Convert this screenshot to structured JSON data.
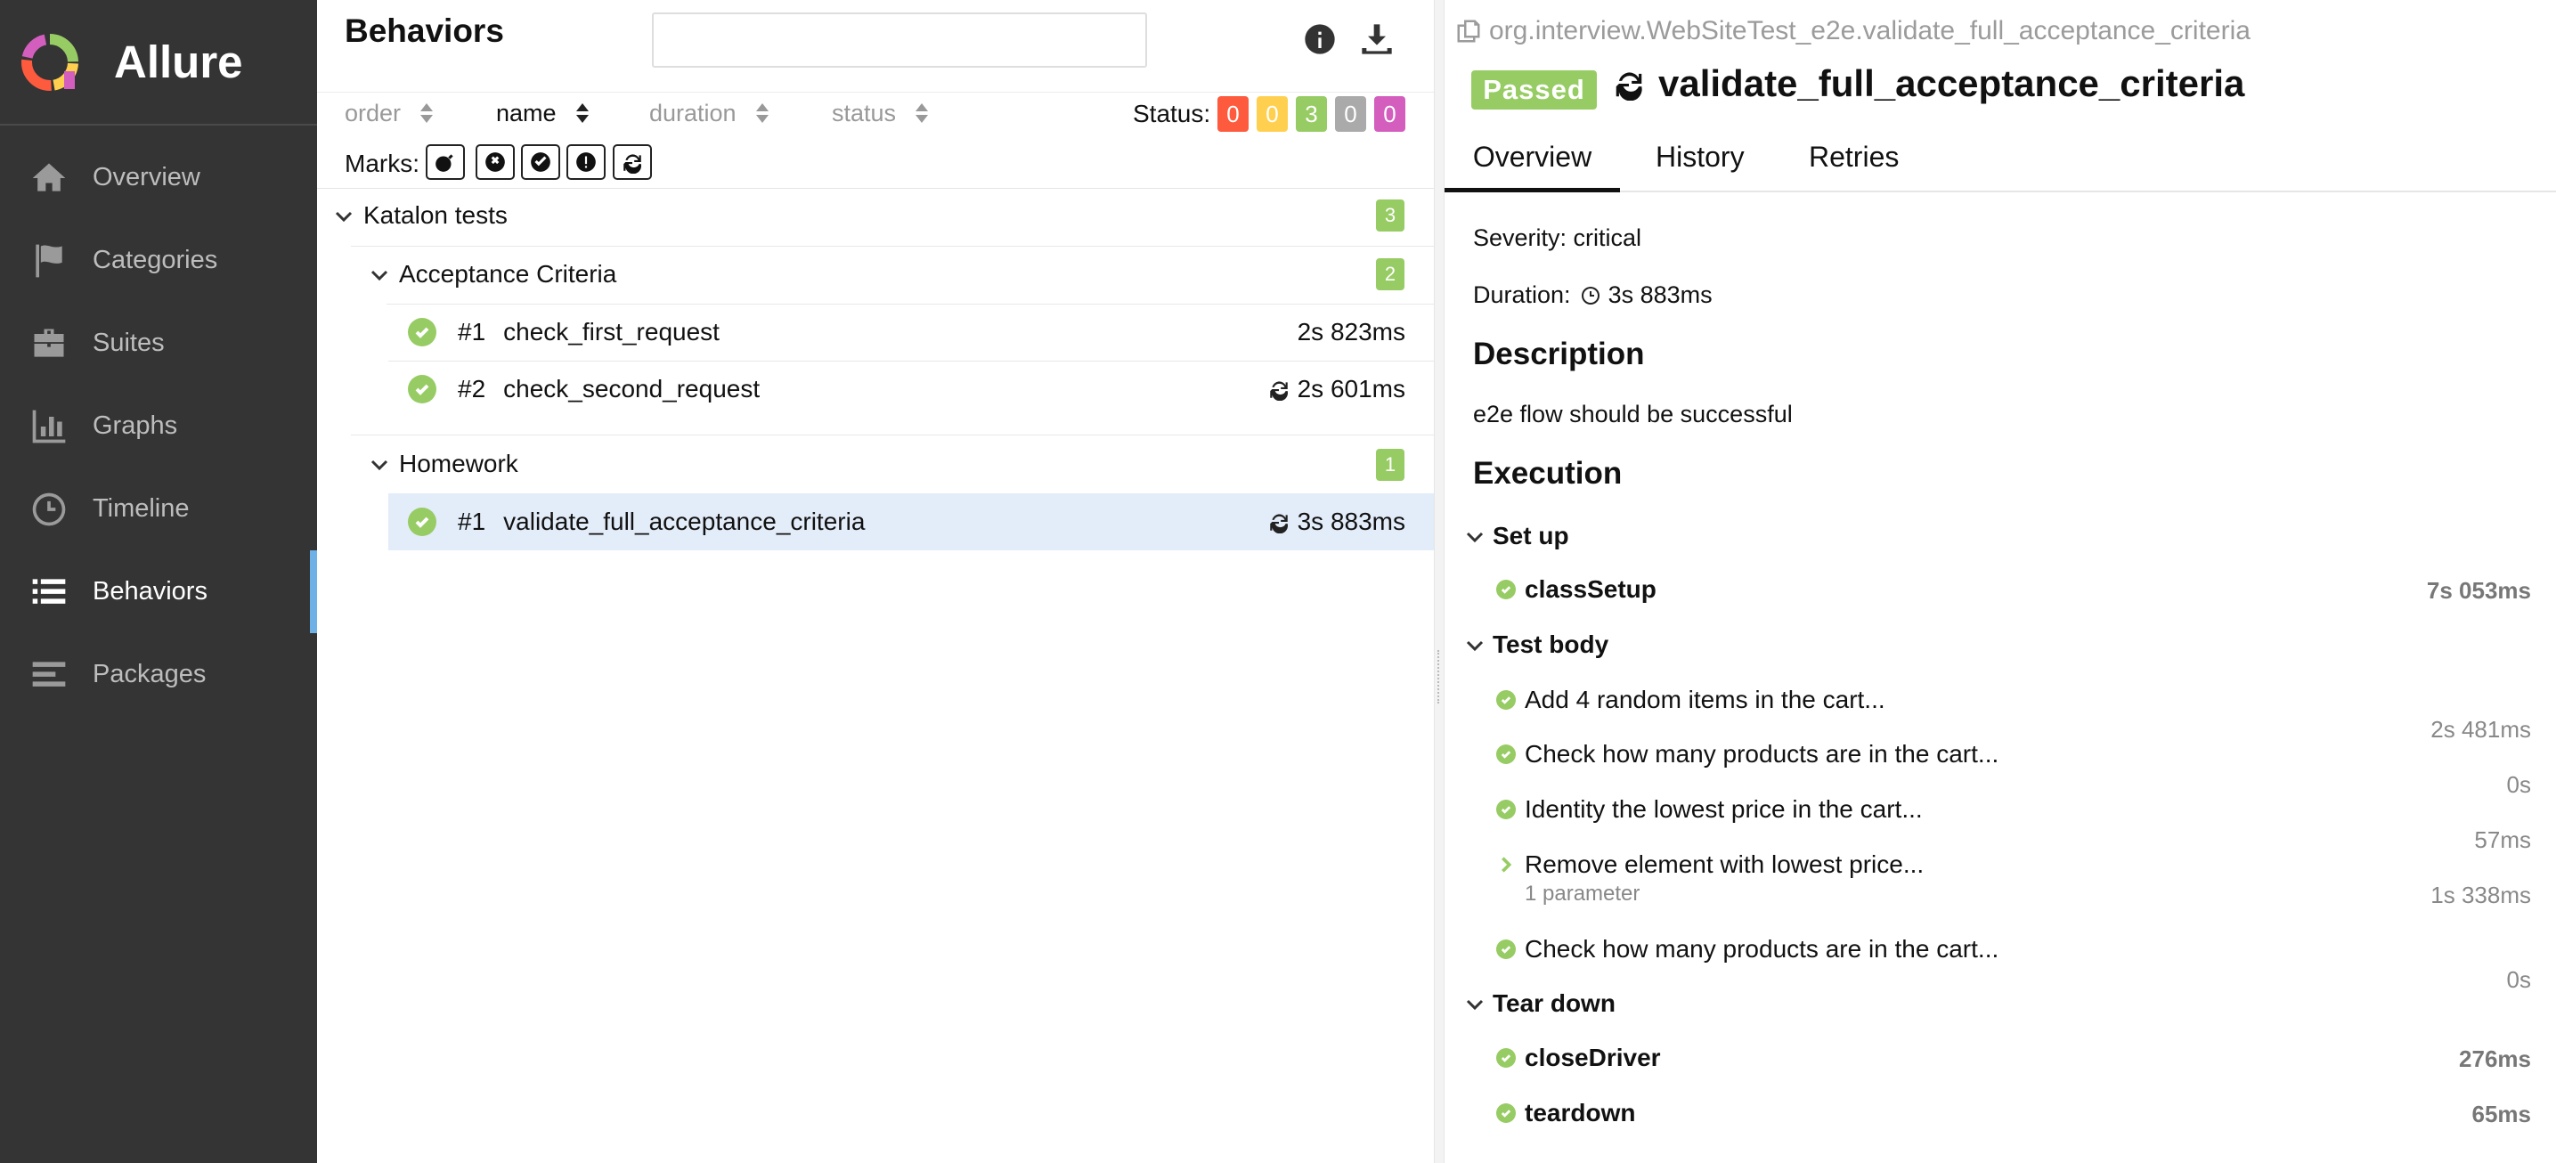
{
  "brand": {
    "name": "Allure"
  },
  "nav": [
    {
      "label": "Overview",
      "icon": "home-icon"
    },
    {
      "label": "Categories",
      "icon": "flag-icon"
    },
    {
      "label": "Suites",
      "icon": "briefcase-icon"
    },
    {
      "label": "Graphs",
      "icon": "bar-chart-icon"
    },
    {
      "label": "Timeline",
      "icon": "clock-icon"
    },
    {
      "label": "Behaviors",
      "icon": "list-icon",
      "active": true
    },
    {
      "label": "Packages",
      "icon": "align-left-icon"
    }
  ],
  "behaviors": {
    "title": "Behaviors",
    "search_placeholder": "",
    "sort": {
      "order": "order",
      "name": "name",
      "duration": "duration",
      "status": "status"
    },
    "status_label": "Status:",
    "status_counts": [
      {
        "value": "0",
        "color": "#fd5a3e"
      },
      {
        "value": "0",
        "color": "#ffd050"
      },
      {
        "value": "3",
        "color": "#97cc64"
      },
      {
        "value": "0",
        "color": "#aaaaaa"
      },
      {
        "value": "0",
        "color": "#d35ebe"
      }
    ],
    "marks_label": "Marks:",
    "tree": {
      "root": {
        "label": "Katalon tests",
        "count": "3"
      },
      "group1": {
        "label": "Acceptance Criteria",
        "count": "2"
      },
      "g1_items": [
        {
          "num": "#1",
          "name": "check_first_request",
          "duration": "2s 823ms"
        },
        {
          "num": "#2",
          "name": "check_second_request",
          "duration": "2s 601ms"
        }
      ],
      "group2": {
        "label": "Homework",
        "count": "1"
      },
      "g2_items": [
        {
          "num": "#1",
          "name": "validate_full_acceptance_criteria",
          "duration": "3s 883ms"
        }
      ]
    }
  },
  "detail": {
    "path": "org.interview.WebSiteTest_e2e.validate_full_acceptance_criteria",
    "status": "Passed",
    "title": "validate_full_acceptance_criteria",
    "tabs": [
      "Overview",
      "History",
      "Retries"
    ],
    "severity": "Severity: critical",
    "duration_label": "Duration:",
    "duration_value": "3s 883ms",
    "description_heading": "Description",
    "description": "e2e flow should be successful",
    "execution_heading": "Execution",
    "setup": {
      "label": "Set up",
      "steps": [
        {
          "name": "classSetup",
          "duration": "7s 053ms"
        }
      ]
    },
    "body": {
      "label": "Test body",
      "steps": [
        {
          "name": "Add 4 random items in the cart...",
          "duration": "2s 481ms"
        },
        {
          "name": "Check how many products are in the cart...",
          "duration": "0s"
        },
        {
          "name": "Identity the lowest price in the cart...",
          "duration": "57ms"
        },
        {
          "name": "Remove element with lowest price...",
          "param": "1 parameter",
          "duration": "1s 338ms"
        },
        {
          "name": "Check how many products are in the cart...",
          "duration": "0s"
        }
      ]
    },
    "teardown": {
      "label": "Tear down",
      "steps": [
        {
          "name": "closeDriver",
          "duration": "276ms"
        },
        {
          "name": "teardown",
          "duration": "65ms"
        }
      ]
    }
  }
}
